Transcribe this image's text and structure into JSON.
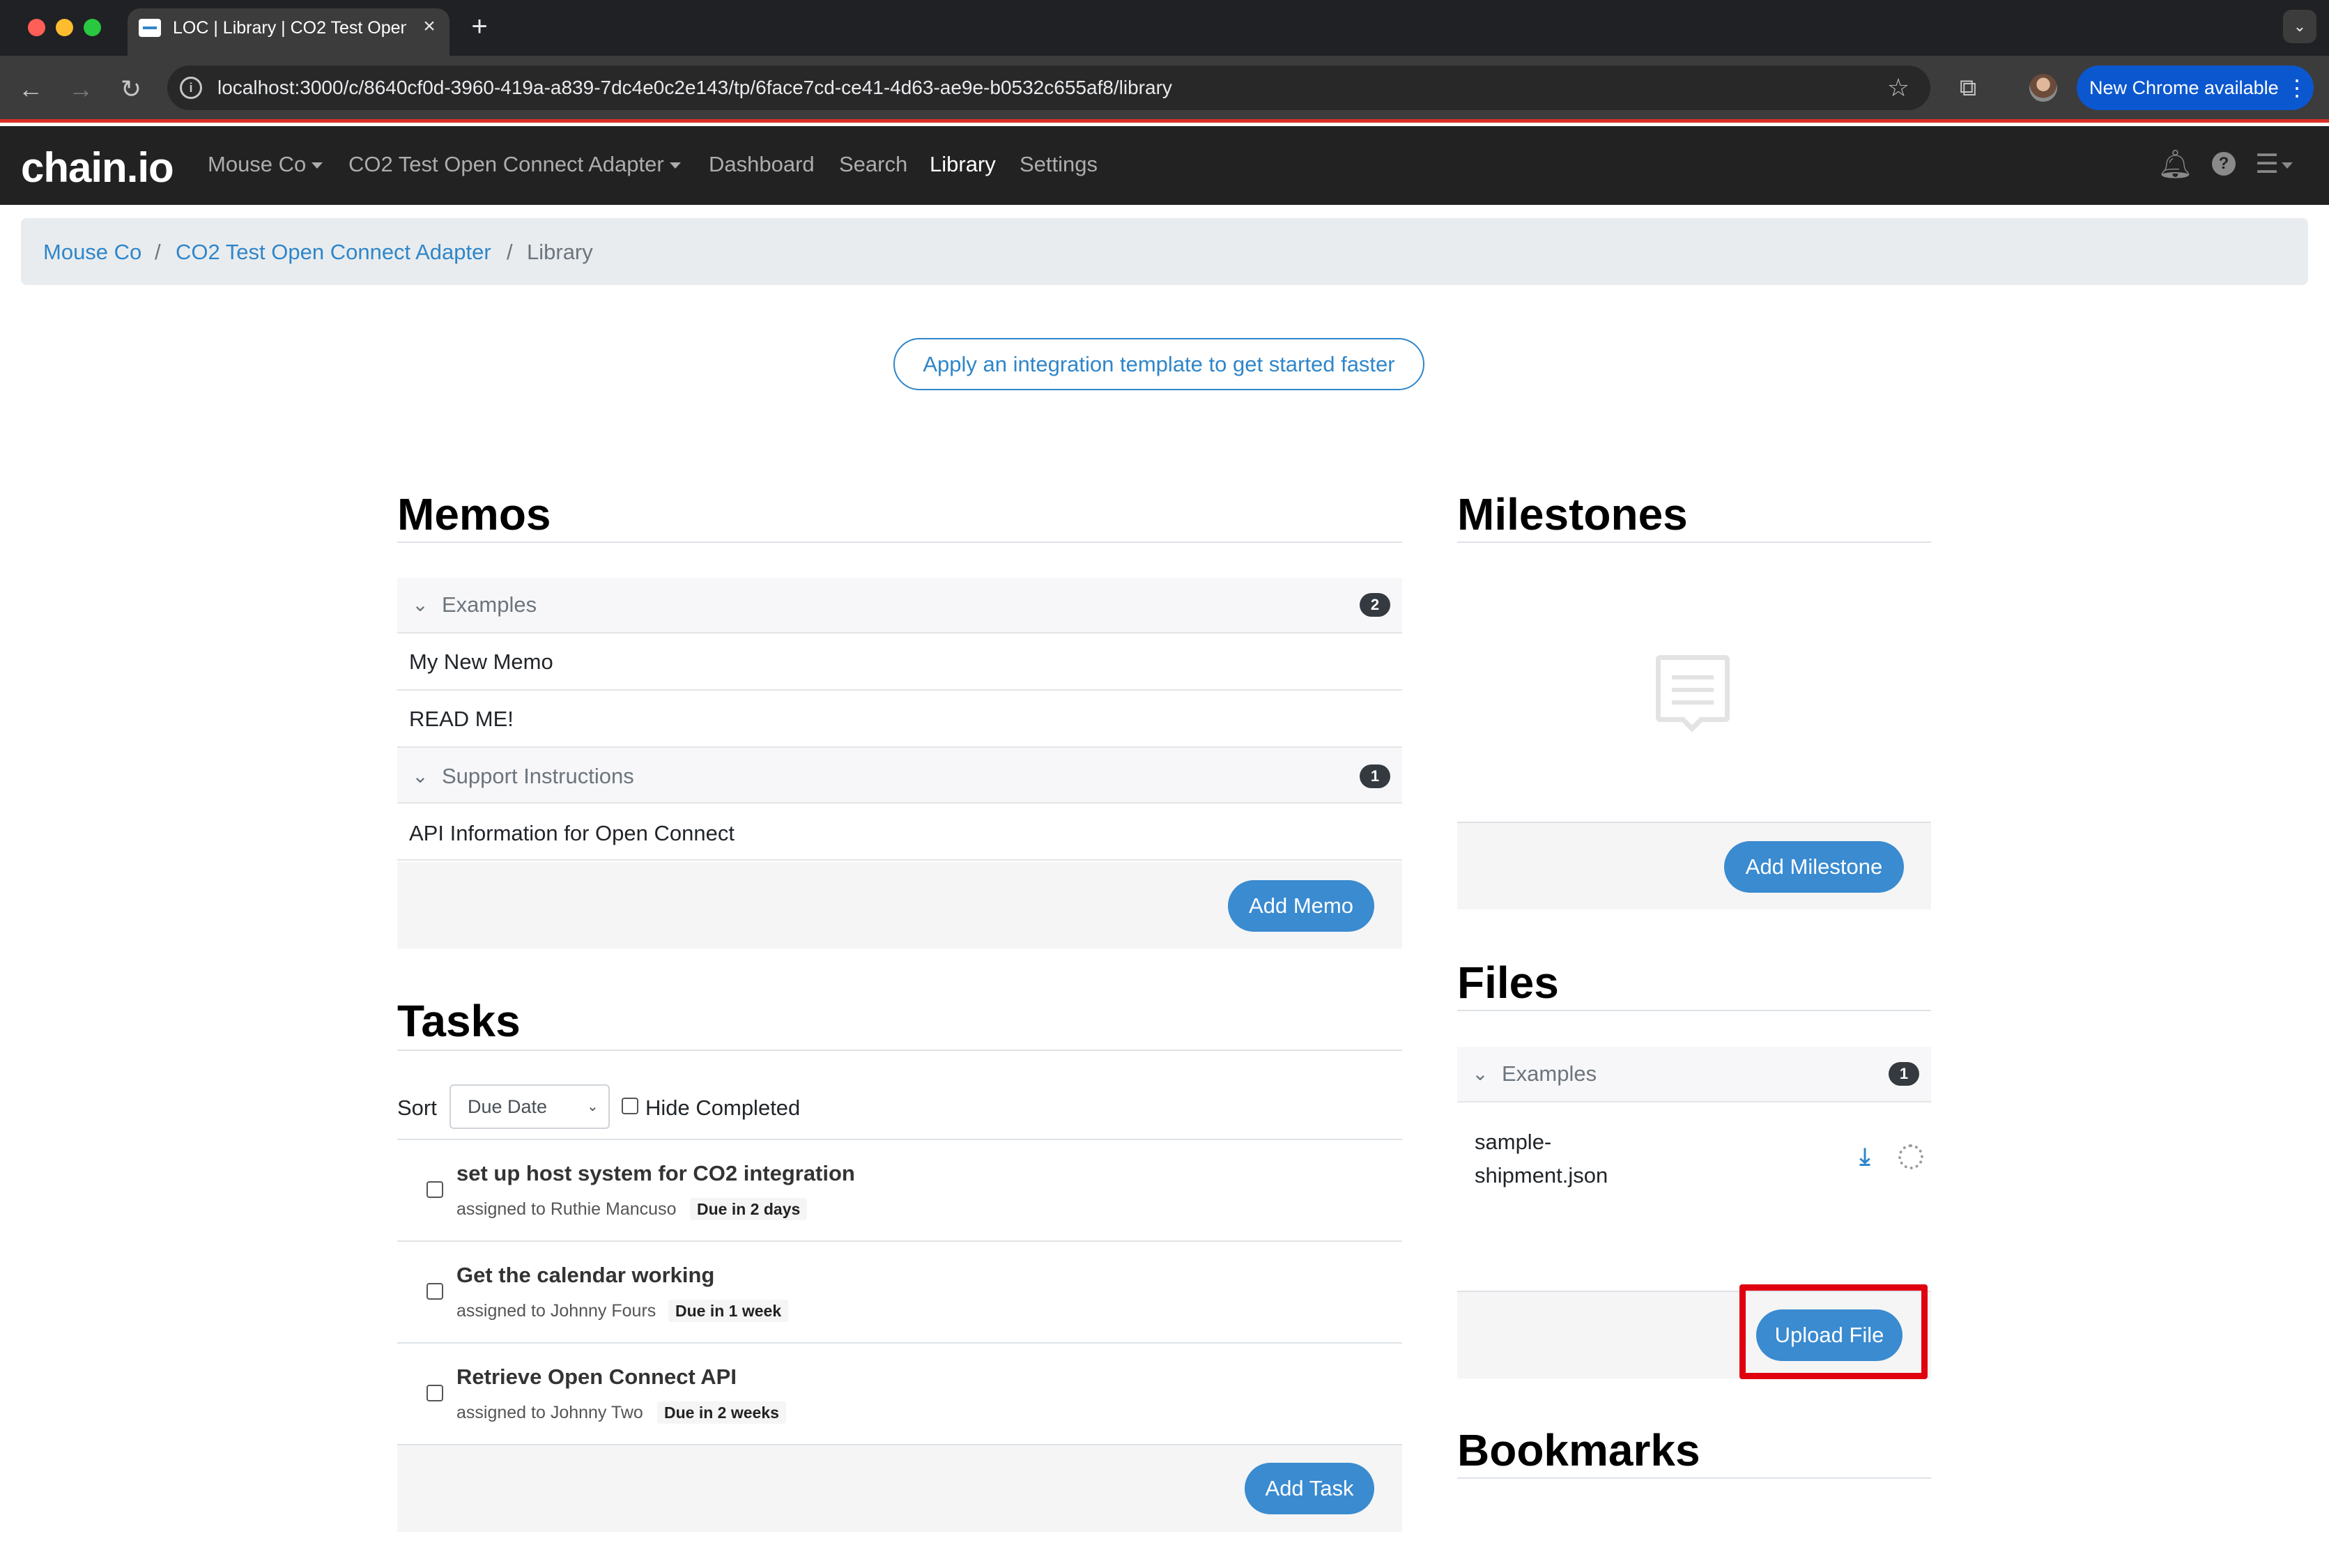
{
  "browser": {
    "tab_title": "LOC | Library | CO2 Test Open Connect Adapter",
    "url": "localhost:3000/c/8640cf0d-3960-419a-a839-7dc4e0c2e143/tp/6face7cd-ce41-4d63-ae9e-b0532c655af8/library",
    "update_label": "New Chrome available",
    "colors": {
      "close": "#ff5f57",
      "minimize": "#febc2e",
      "maximize": "#28c840"
    }
  },
  "navbar": {
    "brand": "chain.io",
    "company": "Mouse Co",
    "adapter": "CO2 Test Open Connect Adapter",
    "links": [
      "Dashboard",
      "Search",
      "Library",
      "Settings"
    ],
    "active": "Library"
  },
  "breadcrumb": {
    "items": [
      "Mouse Co",
      "CO2 Test Open Connect Adapter"
    ],
    "separator": "/",
    "current": "Library"
  },
  "template_button": "Apply an integration template to get started faster",
  "memos": {
    "title": "Memos",
    "groups": [
      {
        "label": "Examples",
        "count": "2",
        "items": [
          "My New Memo",
          "READ ME!"
        ]
      },
      {
        "label": "Support Instructions",
        "count": "1",
        "items": [
          "API Information for Open Connect"
        ]
      }
    ],
    "add_label": "Add Memo"
  },
  "tasks": {
    "title": "Tasks",
    "sort_label": "Sort",
    "sort_value": "Due Date",
    "hide_completed_label": "Hide Completed",
    "items": [
      {
        "title": "set up host system for CO2 integration",
        "assignee": "assigned to Ruthie Mancuso",
        "due": "Due in 2 days"
      },
      {
        "title": "Get the calendar working",
        "assignee": "assigned to Johnny Fours",
        "due": "Due in 1 week"
      },
      {
        "title": "Retrieve Open Connect API",
        "assignee": "assigned to Johnny Two",
        "due": "Due in 2 weeks"
      }
    ],
    "add_label": "Add Task"
  },
  "milestones": {
    "title": "Milestones",
    "empty_icon": "comment-icon",
    "add_label": "Add Milestone"
  },
  "files": {
    "title": "Files",
    "group": {
      "label": "Examples",
      "count": "1"
    },
    "items": [
      {
        "name": "sample-shipment.json"
      }
    ],
    "upload_label": "Upload File",
    "highlight_color": "#e0000f"
  },
  "bookmarks": {
    "title": "Bookmarks"
  },
  "accent_color": "#3a8bd0"
}
